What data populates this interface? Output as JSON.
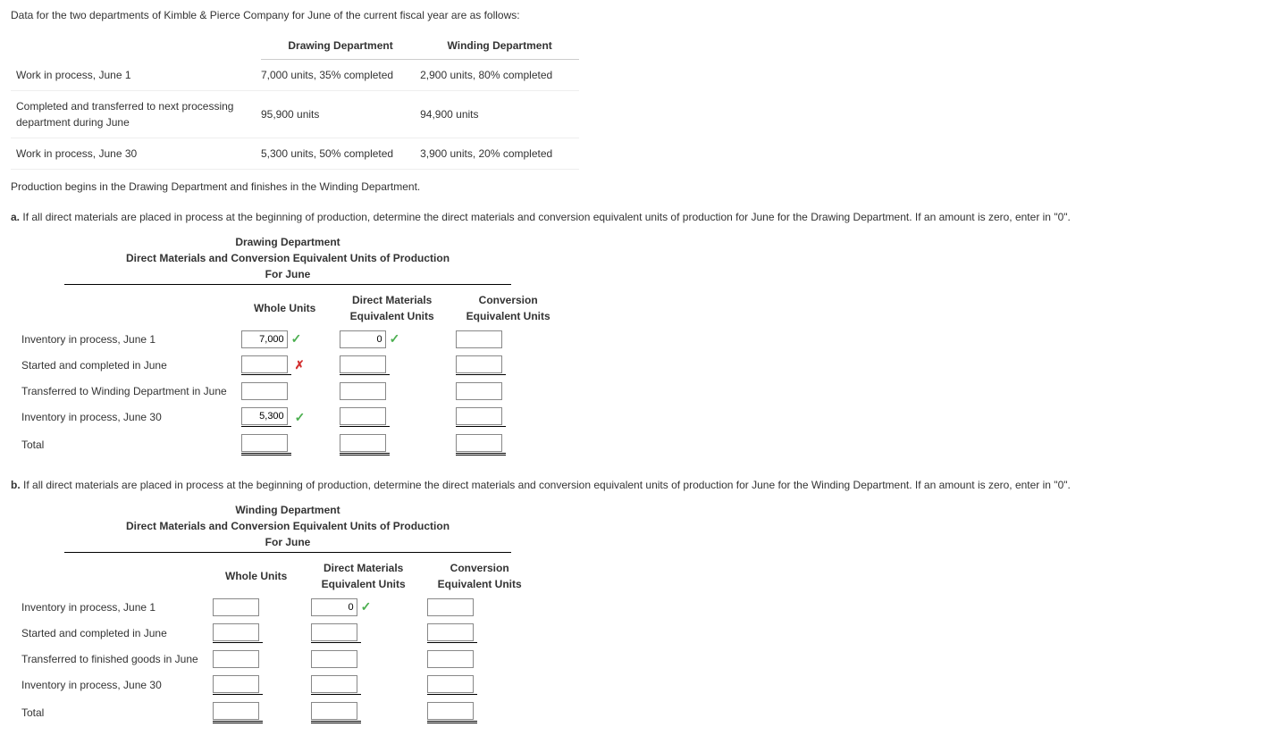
{
  "intro": "Data for the two departments of Kimble & Pierce Company for June of the current fiscal year are as follows:",
  "dataTable": {
    "headers": {
      "col1": "",
      "col2": "Drawing Department",
      "col3": "Winding Department"
    },
    "rows": [
      {
        "label": "Work in process, June 1",
        "drawing": "7,000 units, 35% completed",
        "winding": "2,900 units, 80% completed"
      },
      {
        "label": "Completed and transferred to next processing department during June",
        "drawing": "95,900 units",
        "winding": "94,900 units"
      },
      {
        "label": "Work in process, June 30",
        "drawing": "5,300 units, 50% completed",
        "winding": "3,900 units, 20% completed"
      }
    ]
  },
  "note": "Production begins in the Drawing Department and finishes in the Winding Department.",
  "partA": {
    "marker": "a.",
    "text": "If all direct materials are placed in process at the beginning of production, determine the direct materials and conversion equivalent units of production for June for the Drawing Department. If an amount is zero, enter in \"0\".",
    "title1": "Drawing Department",
    "title2": "Direct Materials and Conversion Equivalent Units of Production",
    "title3": "For June",
    "colHeaders": {
      "whole": "Whole Units",
      "dm": "Direct Materials Equivalent Units",
      "conv": "Conversion Equivalent Units"
    },
    "rows": {
      "r1": {
        "label": "Inventory in process, June 1",
        "whole": "7,000",
        "wholeMark": "check",
        "dm": "0",
        "dmMark": "check",
        "conv": "",
        "convMark": ""
      },
      "r2": {
        "label": "Started and completed in June",
        "whole": "",
        "wholeMark": "x",
        "dm": "",
        "dmMark": "",
        "conv": "",
        "convMark": ""
      },
      "r3": {
        "label": "Transferred to Winding Department in June",
        "whole": "",
        "wholeMark": "",
        "dm": "",
        "dmMark": "",
        "conv": "",
        "convMark": ""
      },
      "r4": {
        "label": "Inventory in process, June 30",
        "whole": "5,300",
        "wholeMark": "check",
        "dm": "",
        "dmMark": "",
        "conv": "",
        "convMark": ""
      },
      "r5": {
        "label": "Total",
        "whole": "",
        "wholeMark": "",
        "dm": "",
        "dmMark": "",
        "conv": "",
        "convMark": ""
      }
    }
  },
  "partB": {
    "marker": "b.",
    "text": "If all direct materials are placed in process at the beginning of production, determine the direct materials and conversion equivalent units of production for June for the Winding Department. If an amount is zero, enter in \"0\".",
    "title1": "Winding Department",
    "title2": "Direct Materials and Conversion Equivalent Units of Production",
    "title3": "For June",
    "colHeaders": {
      "whole": "Whole Units",
      "dm": "Direct Materials Equivalent Units",
      "conv": "Conversion Equivalent Units"
    },
    "rows": {
      "r1": {
        "label": "Inventory in process, June 1",
        "whole": "",
        "dm": "0",
        "dmMark": "check",
        "conv": ""
      },
      "r2": {
        "label": "Started and completed in June",
        "whole": "",
        "dm": "",
        "conv": ""
      },
      "r3": {
        "label": "Transferred to finished goods in June",
        "whole": "",
        "dm": "",
        "conv": ""
      },
      "r4": {
        "label": "Inventory in process, June 30",
        "whole": "",
        "dm": "",
        "conv": ""
      },
      "r5": {
        "label": "Total",
        "whole": "",
        "dm": "",
        "conv": ""
      }
    }
  }
}
